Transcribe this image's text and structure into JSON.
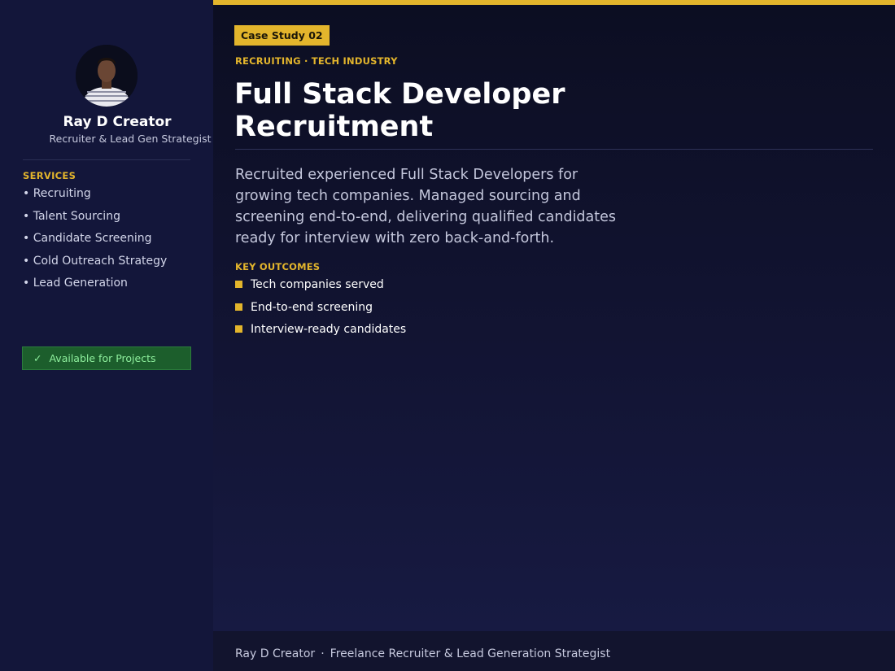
{
  "sidebar": {
    "name": "Ray D Creator",
    "role": "Recruiter & Lead Gen Strategist",
    "services_heading": "SERVICES",
    "services": [
      "• Recruiting",
      "• Talent Sourcing",
      "• Candidate Screening",
      "• Cold Outreach Strategy",
      "• Lead Generation"
    ],
    "availability": {
      "check": "✓",
      "label": "Available for Projects"
    }
  },
  "main": {
    "badge": "Case Study 02",
    "category": "RECRUITING · TECH INDUSTRY",
    "title": "Full Stack Developer Recruitment",
    "description": "Recruited experienced Full Stack Developers for growing tech companies. Managed sourcing and screening end-to-end, delivering qualified candidates ready for interview with zero back-and-forth.",
    "outcomes_heading": "KEY OUTCOMES",
    "outcomes": [
      "Tech companies served",
      "End-to-end screening",
      "Interview-ready candidates"
    ]
  },
  "footer": {
    "name": "Ray D Creator",
    "separator": "·",
    "tagline": "Freelance Recruiter & Lead Generation Strategist"
  },
  "colors": {
    "accent": "#e3b52c",
    "background": "#12142e",
    "sidebar": "#13163a",
    "available_bg": "#1c5e2c",
    "available_text": "#8ff09e"
  }
}
